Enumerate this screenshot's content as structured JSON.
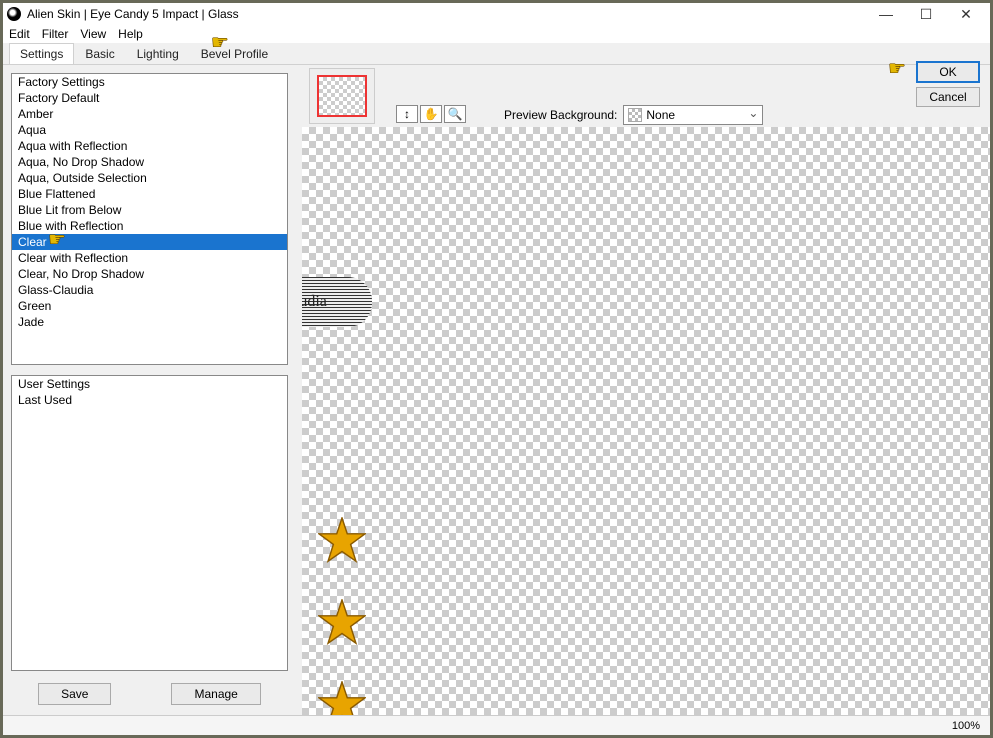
{
  "window": {
    "title": "Alien Skin | Eye Candy 5 Impact | Glass"
  },
  "menu": {
    "items": [
      "Edit",
      "Filter",
      "View",
      "Help"
    ]
  },
  "tabs": {
    "items": [
      "Settings",
      "Basic",
      "Lighting",
      "Bevel Profile"
    ],
    "active": 0
  },
  "factoryList": {
    "header": "Factory Settings",
    "items": [
      "Factory Default",
      "Amber",
      "Aqua",
      "Aqua with Reflection",
      "Aqua, No Drop Shadow",
      "Aqua, Outside Selection",
      "Blue Flattened",
      "Blue Lit from Below",
      "Blue with Reflection",
      "Clear",
      "Clear with Reflection",
      "Clear, No Drop Shadow",
      "Glass-Claudia",
      "Green",
      "Jade"
    ],
    "selected": "Clear"
  },
  "userList": {
    "header": "User Settings",
    "items": [
      "Last Used"
    ]
  },
  "buttons": {
    "save": "Save",
    "manage": "Manage",
    "ok": "OK",
    "cancel": "Cancel"
  },
  "previewBg": {
    "label": "Preview Background:",
    "value": "None"
  },
  "icons": {
    "move": "↕",
    "hand": "✋",
    "zoom": "🔍"
  },
  "status": {
    "zoom": "100%"
  },
  "watermark": "Claudia"
}
